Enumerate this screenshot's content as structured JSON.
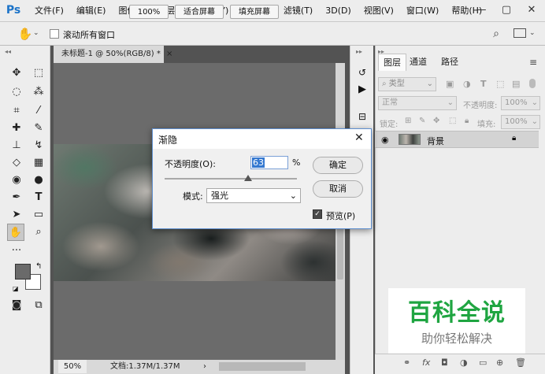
{
  "app": {
    "logo": "Ps"
  },
  "menu": [
    "文件(F)",
    "编辑(E)",
    "图像(I)",
    "图层(L)",
    "文字(Y)",
    "选择(S)",
    "滤镜(T)",
    "3D(D)",
    "视图(V)",
    "窗口(W)",
    "帮助(H)"
  ],
  "window_controls": {
    "minimize": "—",
    "maximize": "▢",
    "close": "✕"
  },
  "options_bar": {
    "scroll_all_label": "滚动所有窗口",
    "zoom_value": "100%",
    "fit_screen": "适合屏幕",
    "fill_screen": "填充屏幕"
  },
  "document": {
    "tab_title": "未标题-1 @ 50%(RGB/8) *",
    "tab_close": "×",
    "zoom": "50%",
    "doc_info": "文档:1.37M/1.37M"
  },
  "layers_panel": {
    "tabs": [
      "图层",
      "通道",
      "路径"
    ],
    "filter_kind": "类型",
    "blend_mode": "正常",
    "opacity_label": "不透明度:",
    "opacity_value": "100%",
    "lock_label": "锁定:",
    "fill_label": "填充:",
    "fill_value": "100%",
    "layer_name": "背景"
  },
  "fade_dialog": {
    "title": "渐隐",
    "opacity_label": "不透明度(O):",
    "opacity_value": "63",
    "percent": "%",
    "opacity_fraction": 0.63,
    "mode_label": "模式:",
    "mode_value": "强光",
    "ok": "确定",
    "cancel": "取消",
    "preview_label": "预览(P)",
    "preview_checked": true
  },
  "watermark": {
    "main": "百科全说",
    "sub": "助你轻松解决"
  },
  "colors": {
    "ps_blue": "#1c73c8",
    "selection_blue": "#3478d0",
    "watermark_green": "#1fa541"
  }
}
